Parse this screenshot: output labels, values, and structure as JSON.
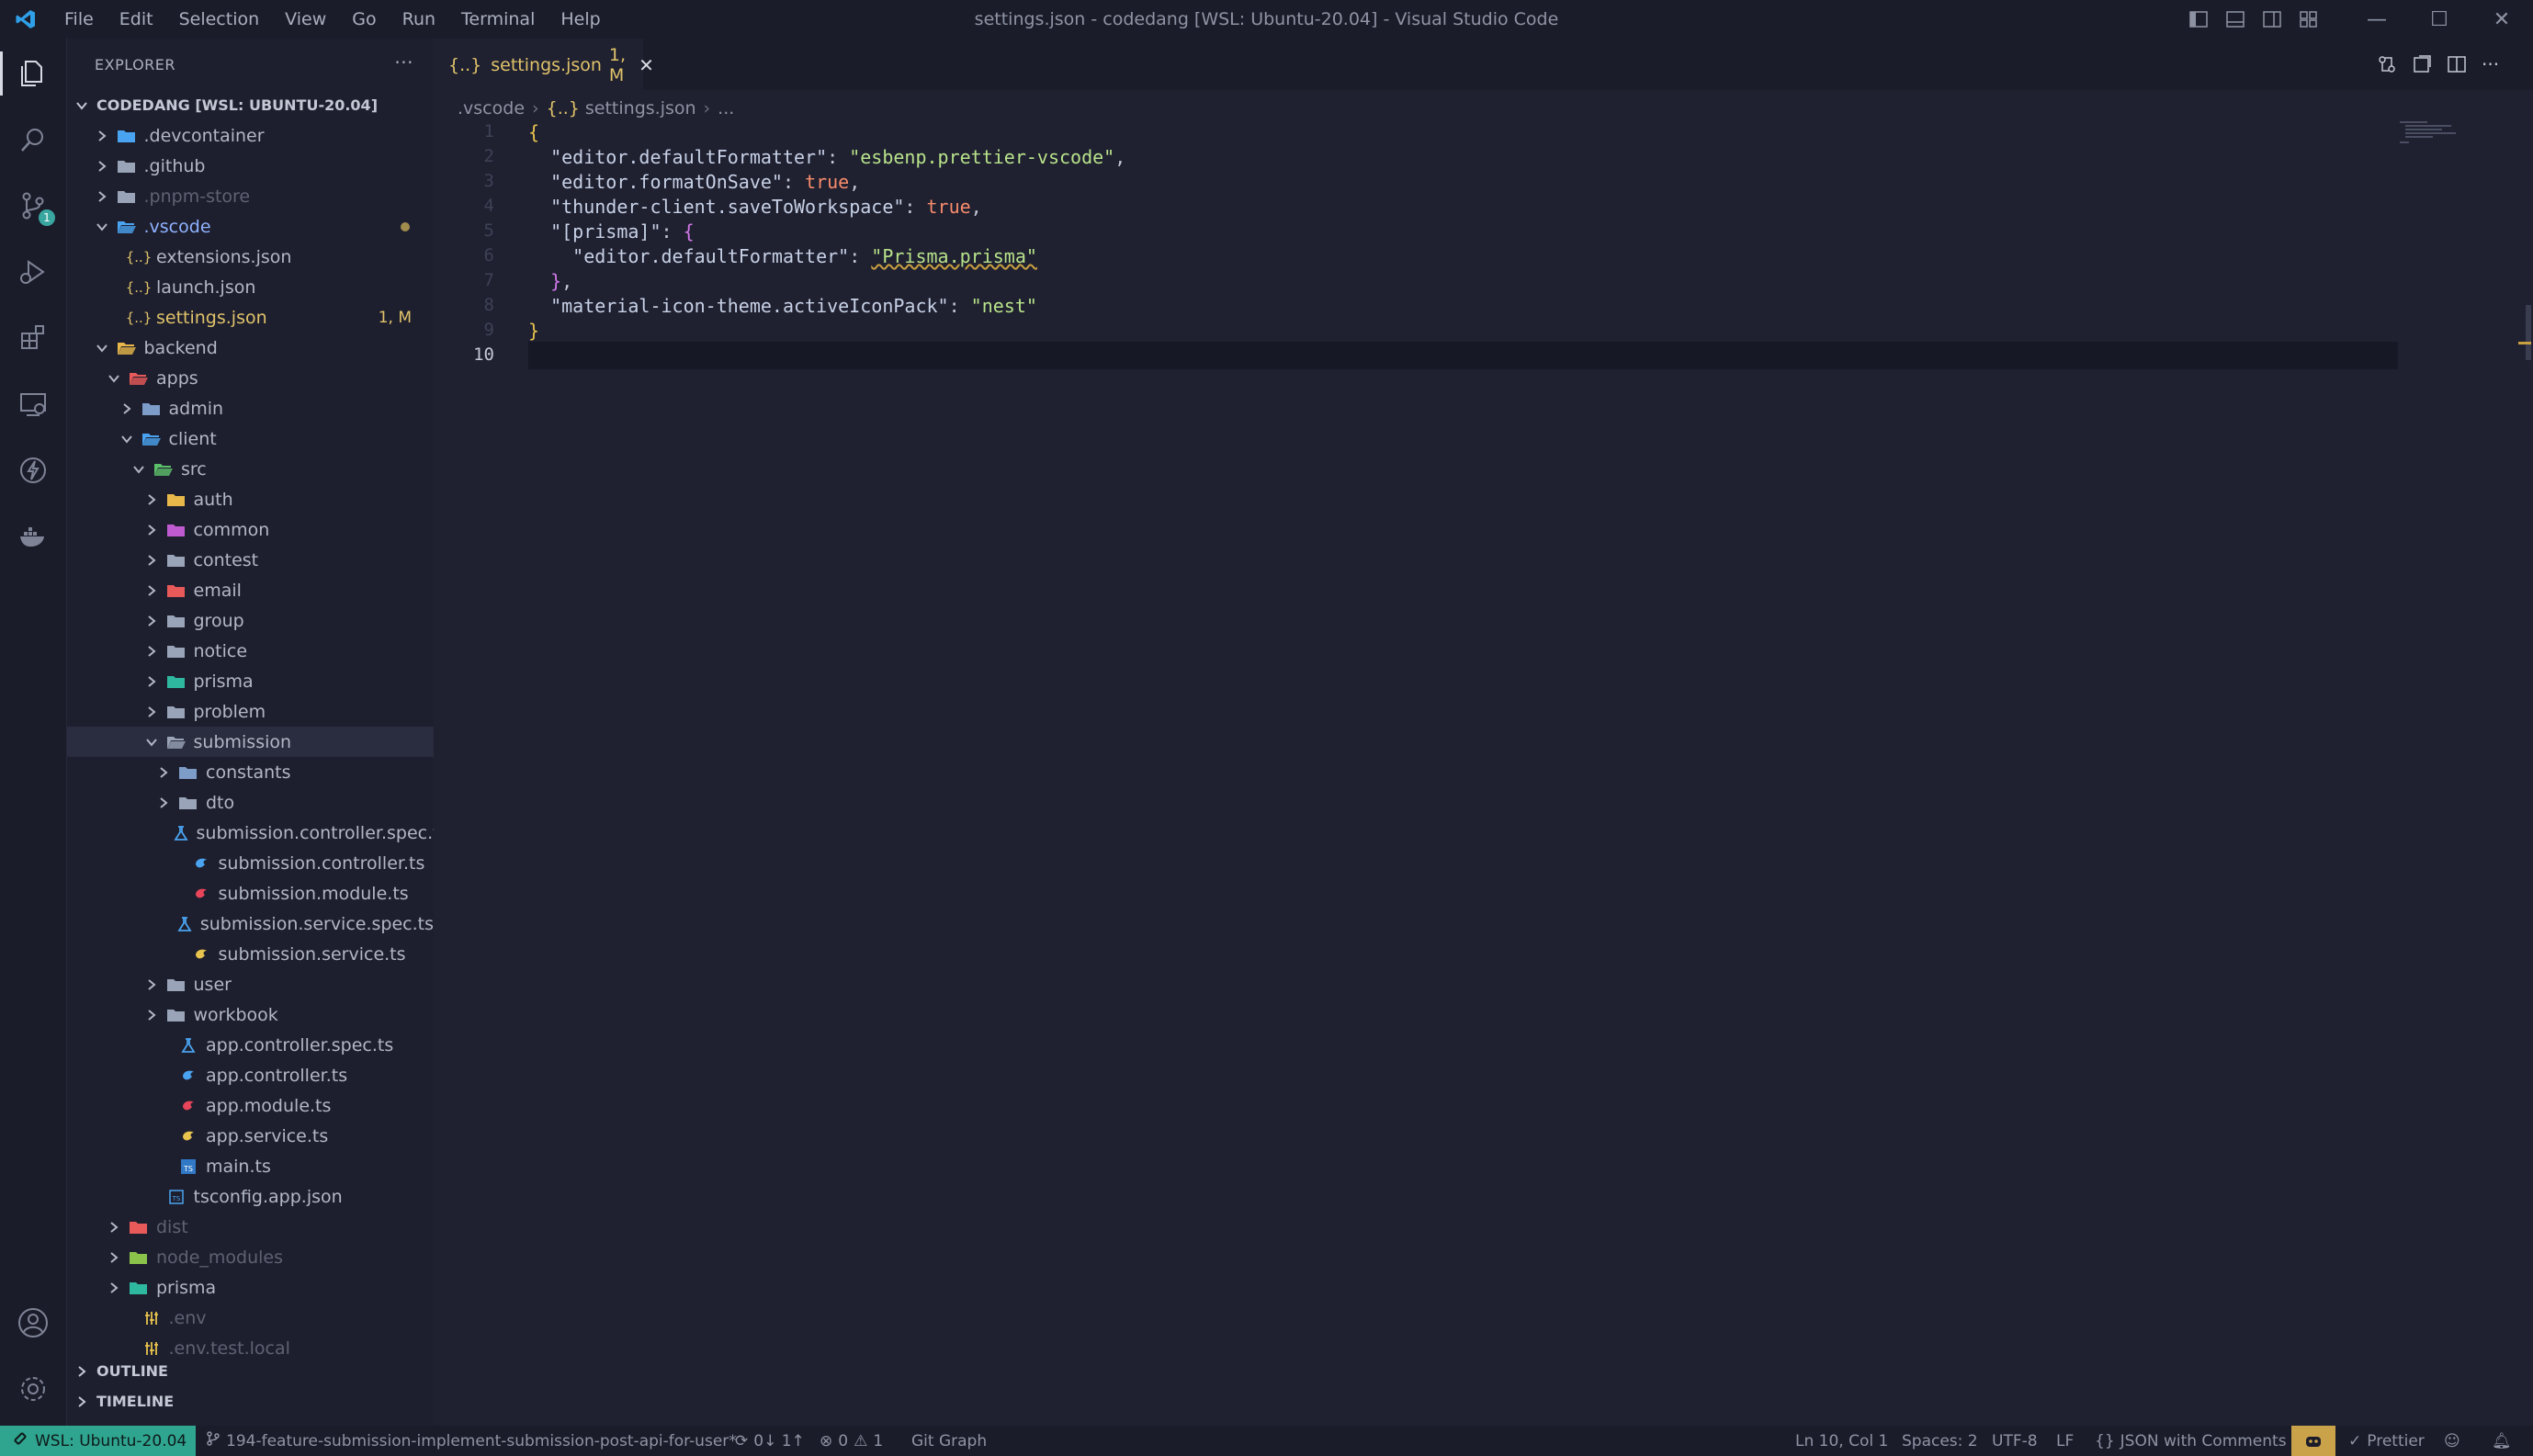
{
  "window": {
    "title": "settings.json - codedang [WSL: Ubuntu-20.04] - Visual Studio Code",
    "menu": [
      "File",
      "Edit",
      "Selection",
      "View",
      "Go",
      "Run",
      "Terminal",
      "Help"
    ]
  },
  "activity_bar": {
    "items": [
      "explorer-icon",
      "search-icon",
      "source-control-icon",
      "run-debug-icon",
      "extensions-icon",
      "remote-explorer-icon",
      "thunder-client-icon",
      "docker-icon"
    ],
    "source_control_badge": "1",
    "bottom": [
      "account-icon",
      "settings-gear-icon"
    ]
  },
  "sidebar": {
    "title": "EXPLORER",
    "more": "···",
    "root": "CODEDANG [WSL: UBUNTU-20.04]",
    "items": [
      {
        "label": ".devcontainer",
        "depth": 1,
        "type": "folder",
        "open": false,
        "icon_color": "#4aa3f0"
      },
      {
        "label": ".github",
        "depth": 1,
        "type": "folder",
        "open": false,
        "icon_color": "#9aa4b8"
      },
      {
        "label": ".pnpm-store",
        "depth": 1,
        "type": "folder",
        "open": false,
        "dim": true,
        "icon_color": "#9aa4b8"
      },
      {
        "label": ".vscode",
        "depth": 1,
        "type": "folder",
        "open": true,
        "accent": true,
        "dot": true,
        "icon_color": "#4aa3f0"
      },
      {
        "label": "extensions.json",
        "depth": 2,
        "type": "json"
      },
      {
        "label": "launch.json",
        "depth": 2,
        "type": "json"
      },
      {
        "label": "settings.json",
        "depth": 2,
        "type": "json",
        "modified": true,
        "status": "1, M"
      },
      {
        "label": "backend",
        "depth": 1,
        "type": "folder",
        "open": true,
        "icon_color": "#e8b84a"
      },
      {
        "label": "apps",
        "depth": 2,
        "type": "folder",
        "open": true,
        "icon_color": "#e85a5a"
      },
      {
        "label": "admin",
        "depth": 3,
        "type": "folder",
        "open": false,
        "icon_color": "#7e9cc8"
      },
      {
        "label": "client",
        "depth": 3,
        "type": "folder",
        "open": true,
        "icon_color": "#4aa3f0"
      },
      {
        "label": "src",
        "depth": 4,
        "type": "folder",
        "open": true,
        "icon_color": "#5cbf6a"
      },
      {
        "label": "auth",
        "depth": 5,
        "type": "folder",
        "open": false,
        "icon_color": "#e8b84a"
      },
      {
        "label": "common",
        "depth": 5,
        "type": "folder",
        "open": false,
        "icon_color": "#c05ad0"
      },
      {
        "label": "contest",
        "depth": 5,
        "type": "folder",
        "open": false,
        "icon_color": "#9aa4b8"
      },
      {
        "label": "email",
        "depth": 5,
        "type": "folder",
        "open": false,
        "icon_color": "#e85a5a"
      },
      {
        "label": "group",
        "depth": 5,
        "type": "folder",
        "open": false,
        "icon_color": "#9aa4b8"
      },
      {
        "label": "notice",
        "depth": 5,
        "type": "folder",
        "open": false,
        "icon_color": "#9aa4b8"
      },
      {
        "label": "prisma",
        "depth": 5,
        "type": "folder",
        "open": false,
        "icon_color": "#2fb8a0"
      },
      {
        "label": "problem",
        "depth": 5,
        "type": "folder",
        "open": false,
        "icon_color": "#9aa4b8"
      },
      {
        "label": "submission",
        "depth": 5,
        "type": "folder",
        "open": true,
        "selected": true,
        "icon_color": "#9aa4b8"
      },
      {
        "label": "constants",
        "depth": 6,
        "type": "folder",
        "open": false,
        "icon_color": "#7e9cc8"
      },
      {
        "label": "dto",
        "depth": 6,
        "type": "folder",
        "open": false,
        "icon_color": "#9aa4b8"
      },
      {
        "label": "submission.controller.spec.ts",
        "depth": 7,
        "type": "spec"
      },
      {
        "label": "submission.controller.ts",
        "depth": 7,
        "type": "controller"
      },
      {
        "label": "submission.module.ts",
        "depth": 7,
        "type": "module"
      },
      {
        "label": "submission.service.spec.ts",
        "depth": 7,
        "type": "spec"
      },
      {
        "label": "submission.service.ts",
        "depth": 7,
        "type": "service"
      },
      {
        "label": "user",
        "depth": 5,
        "type": "folder",
        "open": false,
        "icon_color": "#9aa4b8"
      },
      {
        "label": "workbook",
        "depth": 5,
        "type": "folder",
        "open": false,
        "icon_color": "#9aa4b8"
      },
      {
        "label": "app.controller.spec.ts",
        "depth": 6,
        "type": "spec"
      },
      {
        "label": "app.controller.ts",
        "depth": 6,
        "type": "controller"
      },
      {
        "label": "app.module.ts",
        "depth": 6,
        "type": "module"
      },
      {
        "label": "app.service.ts",
        "depth": 6,
        "type": "service"
      },
      {
        "label": "main.ts",
        "depth": 6,
        "type": "ts"
      },
      {
        "label": "tsconfig.app.json",
        "depth": 5,
        "type": "tsconfig"
      },
      {
        "label": "dist",
        "depth": 2,
        "type": "folder",
        "open": false,
        "dim": true,
        "icon_color": "#e85a5a"
      },
      {
        "label": "node_modules",
        "depth": 2,
        "type": "folder",
        "open": false,
        "dim": true,
        "icon_color": "#8bc34a"
      },
      {
        "label": "prisma",
        "depth": 2,
        "type": "folder",
        "open": false,
        "icon_color": "#2fb8a0"
      },
      {
        "label": ".env",
        "depth": 3,
        "type": "env",
        "dim": true
      },
      {
        "label": ".env.test.local",
        "depth": 3,
        "type": "env",
        "dim": true
      }
    ],
    "outline": "OUTLINE",
    "timeline": "TIMELINE"
  },
  "editor": {
    "tab": {
      "icon": "{..}",
      "label": "settings.json",
      "status": "1, M",
      "close": "✕"
    },
    "breadcrumb": [
      ".vscode",
      "settings.json",
      "..."
    ],
    "breadcrumb_icon": "{..}",
    "line_numbers": [
      "1",
      "2",
      "3",
      "4",
      "5",
      "6",
      "7",
      "8",
      "9",
      "10"
    ],
    "current_line": "10"
  },
  "statusbar": {
    "remote": "WSL: Ubuntu-20.04",
    "branch": "194-feature-submission-implement-submission-post-api-for-user*",
    "sync": "0↓ 1↑",
    "errors": "0",
    "warnings": "1",
    "git_graph": "Git Graph",
    "position": "Ln 10, Col 1",
    "spaces": "Spaces: 2",
    "encoding": "UTF-8",
    "eol": "LF",
    "language": "JSON with Comments",
    "prettier": "Prettier"
  }
}
